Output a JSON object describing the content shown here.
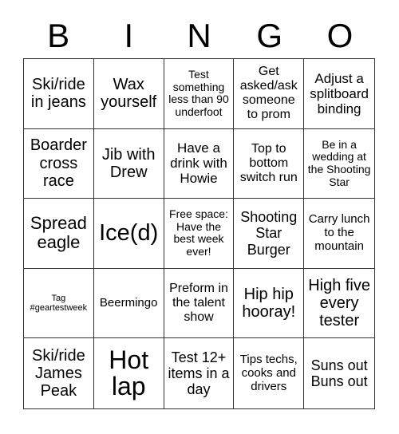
{
  "header": {
    "letters": [
      "B",
      "I",
      "N",
      "G",
      "O"
    ]
  },
  "cells": [
    "Ski/ride in jeans",
    "Wax yourself",
    "Test something less than 90 underfoot",
    "Get asked/ask someone to prom",
    "Adjust a splitboard binding",
    "Boarder cross race",
    "Jib with Drew",
    "Have a drink with Howie",
    "Top to bottom switch run",
    "Be in a wedding at the Shooting Star",
    "Spread eagle",
    "Ice(d)",
    "Free space: Have the best week ever!",
    "Shooting Star Burger",
    "Carry lunch to the mountain",
    "Tag #geartestweek",
    "Beermingo",
    "Preform in the talent show",
    "Hip hip hooray!",
    "High five every tester",
    "Ski/ride James Peak",
    "Hot lap",
    "Test 12+ items in a day",
    "Tips techs, cooks and drivers",
    "Suns out Buns out"
  ]
}
